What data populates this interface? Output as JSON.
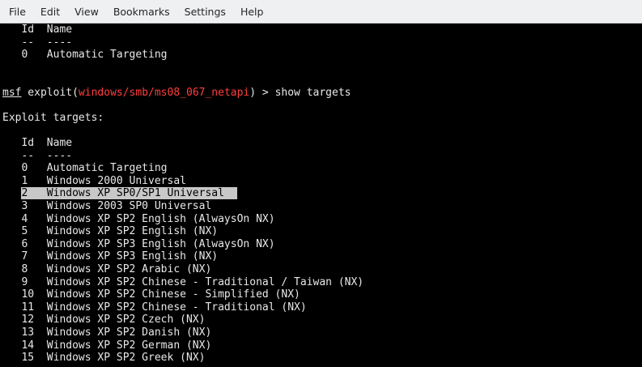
{
  "menubar": {
    "items": [
      "File",
      "Edit",
      "View",
      "Bookmarks",
      "Settings",
      "Help"
    ]
  },
  "terminal": {
    "top_block": [
      "   Id  Name",
      "   --  ----",
      "   0   Automatic Targeting"
    ],
    "prompt": {
      "msf": "msf",
      "before_module": " exploit(",
      "module": "windows/smb/ms08_067_netapi",
      "after_module": ") > show targets"
    },
    "exploit_targets_heading": "Exploit targets:",
    "targets_header": [
      "   Id  Name",
      "   --  ----"
    ],
    "targets_before": [
      "   0   Automatic Targeting",
      "   1   Windows 2000 Universal"
    ],
    "selected_indent": "   ",
    "selected_target": "2   Windows XP SP0/SP1 Universal  ",
    "targets_after": [
      "   3   Windows 2003 SP0 Universal",
      "   4   Windows XP SP2 English (AlwaysOn NX)",
      "   5   Windows XP SP2 English (NX)",
      "   6   Windows XP SP3 English (AlwaysOn NX)",
      "   7   Windows XP SP3 English (NX)",
      "   8   Windows XP SP2 Arabic (NX)",
      "   9   Windows XP SP2 Chinese - Traditional / Taiwan (NX)",
      "   10  Windows XP SP2 Chinese - Simplified (NX)",
      "   11  Windows XP SP2 Chinese - Traditional (NX)",
      "   12  Windows XP SP2 Czech (NX)",
      "   13  Windows XP SP2 Danish (NX)",
      "   14  Windows XP SP2 German (NX)",
      "   15  Windows XP SP2 Greek (NX)"
    ]
  }
}
